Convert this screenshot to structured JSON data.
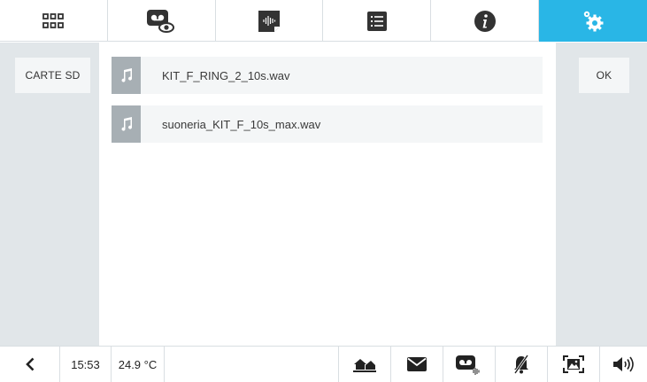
{
  "topbar": {
    "tabs": [
      {
        "name": "grid-icon",
        "active": false
      },
      {
        "name": "videomemo-icon",
        "active": false
      },
      {
        "name": "audio-message-icon",
        "active": false
      },
      {
        "name": "list-icon",
        "active": false
      },
      {
        "name": "info-icon",
        "active": false
      },
      {
        "name": "settings-icon",
        "active": true
      }
    ]
  },
  "left": {
    "sd_label": "CARTE SD"
  },
  "right": {
    "ok_label": "OK"
  },
  "files": [
    {
      "name": "KIT_F_RING_2_10s.wav",
      "icon": "music-note-icon"
    },
    {
      "name": "suoneria_KIT_F_10s_max.wav",
      "icon": "music-note-icon"
    }
  ],
  "status": {
    "time": "15:53",
    "temperature": "24.9 °C"
  },
  "bottom_icons": [
    "back-icon",
    "home-away-icon",
    "mail-icon",
    "videomemo-audio-icon",
    "ringer-off-icon",
    "fullscreen-icon",
    "volume-icon"
  ],
  "colors": {
    "accent": "#29b6e6",
    "panel": "#e1e6e9",
    "row": "#f4f6f7",
    "file_icon_bg": "#a7afb4"
  }
}
